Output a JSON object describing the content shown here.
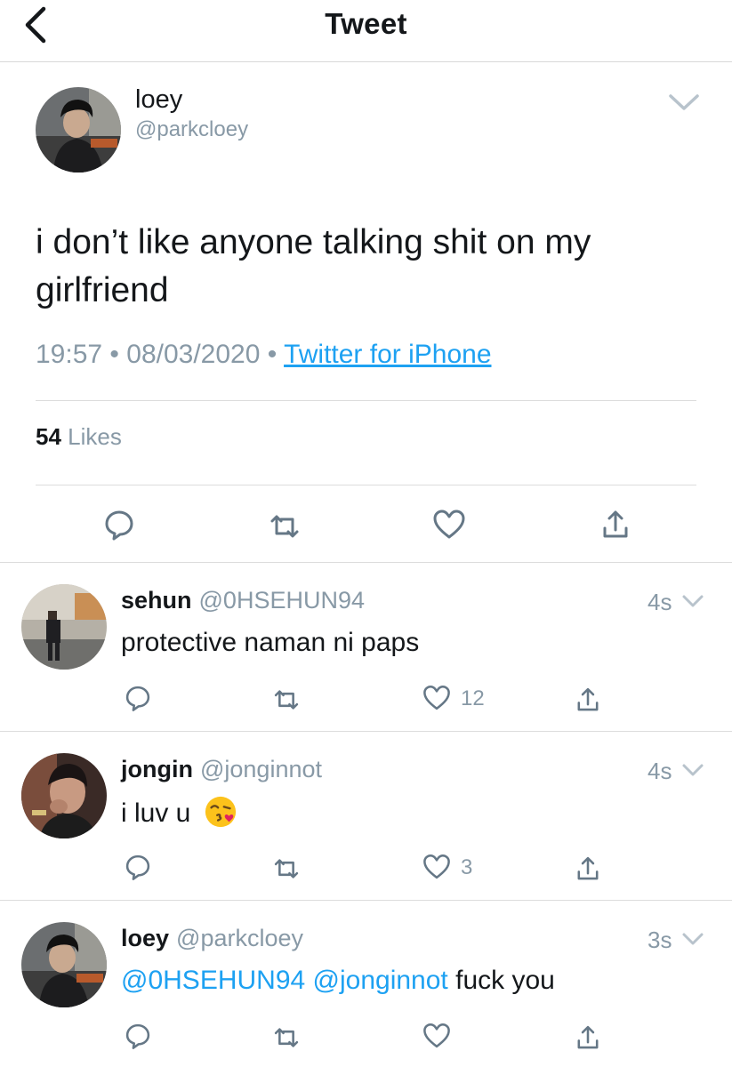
{
  "header": {
    "title": "Tweet"
  },
  "main_tweet": {
    "name": "loey",
    "handle": "@parkcloey",
    "text": "i don’t like anyone talking shit on my girlfriend",
    "time": "19:57",
    "date": "08/03/2020",
    "source": "Twitter for iPhone",
    "likes_count": "54",
    "likes_label": "Likes"
  },
  "replies": [
    {
      "name": "sehun",
      "handle": "@0HSEHUN94",
      "time": "4s",
      "text": "protective naman ni paps",
      "likes": "12"
    },
    {
      "name": "jongin",
      "handle": "@jonginnot",
      "time": "4s",
      "text": "i luv u",
      "likes": "3"
    },
    {
      "name": "loey",
      "handle": "@parkcloey",
      "time": "3s",
      "mention1": "@0HSEHUN94",
      "mention2": "@jonginnot",
      "text_rest": "fuck you",
      "likes": ""
    }
  ],
  "colors": {
    "accent": "#1da1f2",
    "muted": "#8899a6",
    "text": "#14171a"
  }
}
